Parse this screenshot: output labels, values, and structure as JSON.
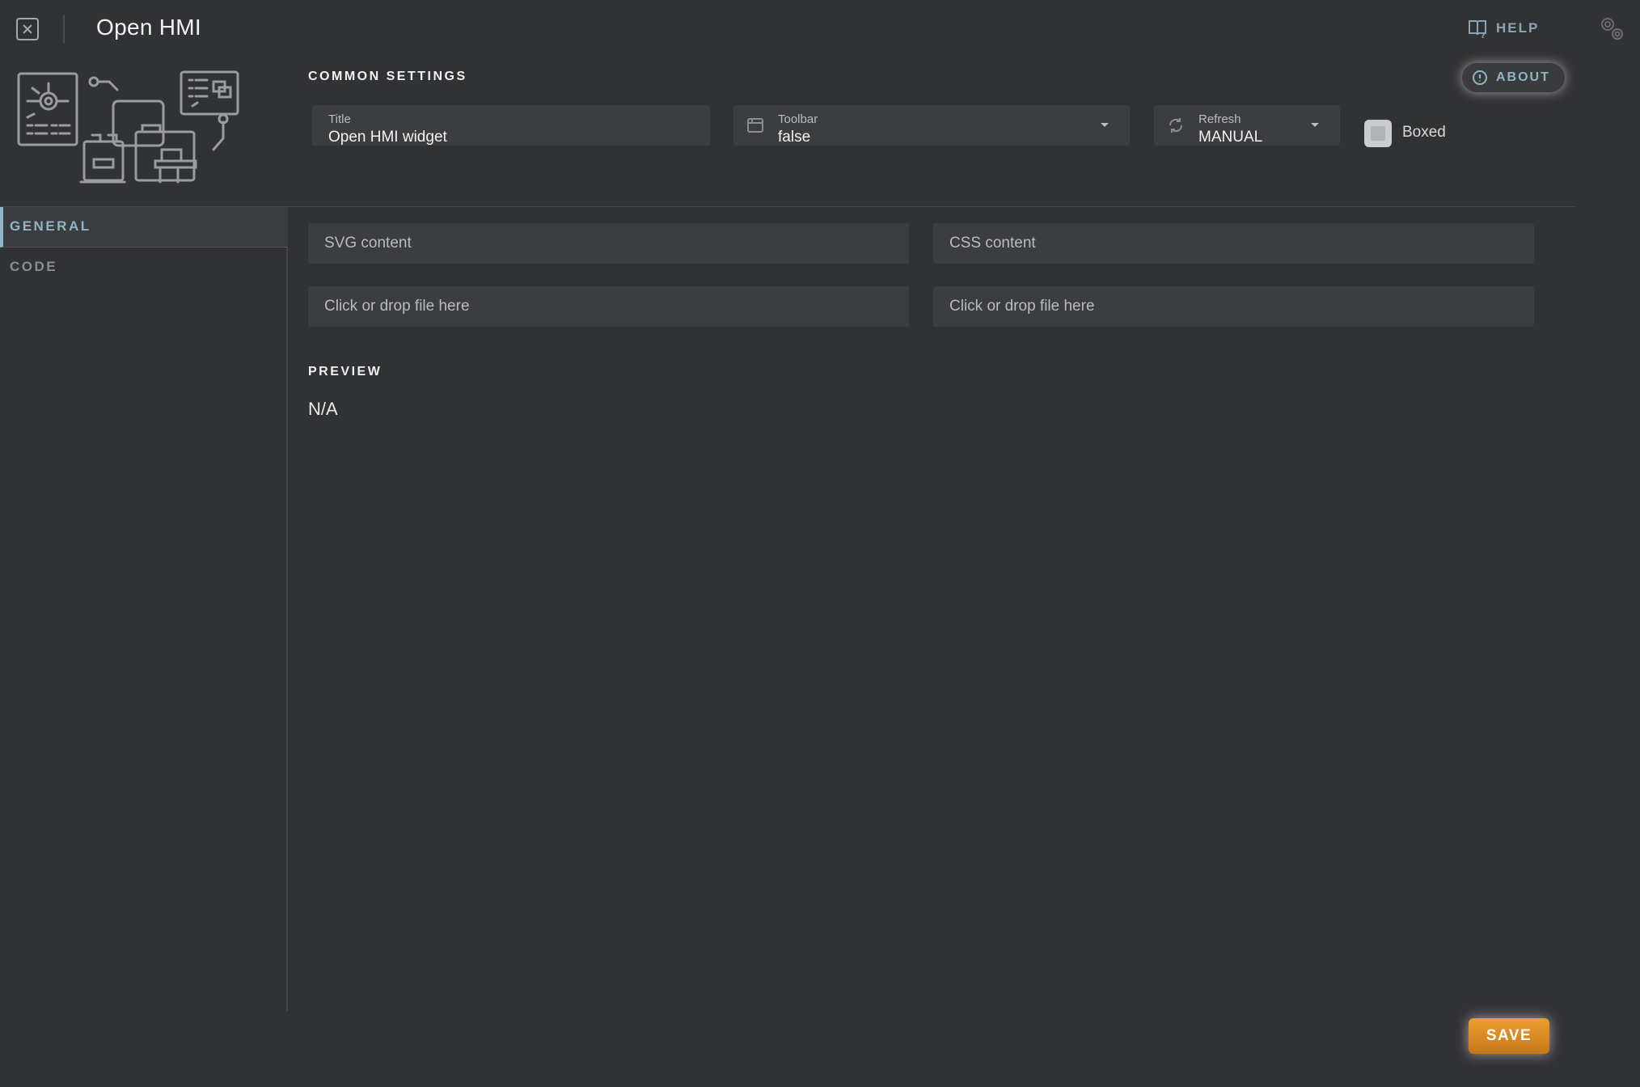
{
  "header": {
    "app_title": "Open HMI",
    "help_label": "HELP"
  },
  "settings": {
    "section_title": "COMMON SETTINGS",
    "about_label": "ABOUT",
    "title_field": {
      "label": "Title",
      "value": "Open HMI widget"
    },
    "toolbar_field": {
      "label": "Toolbar",
      "value": "false"
    },
    "refresh_field": {
      "label": "Refresh",
      "value": "MANUAL"
    },
    "boxed_label": "Boxed",
    "boxed_checked": false
  },
  "sidebar": {
    "items": [
      {
        "label": "GENERAL",
        "active": true
      },
      {
        "label": "CODE",
        "active": false
      }
    ]
  },
  "content": {
    "svg_content_label": "SVG content",
    "css_content_label": "CSS content",
    "svg_drop_text": "Click or drop file here",
    "css_drop_text": "Click or drop file here",
    "preview_title": "PREVIEW",
    "preview_value": "N/A"
  },
  "footer": {
    "save_label": "SAVE"
  },
  "colors": {
    "background": "#313234",
    "accent": "#8fb6c4",
    "save": "#e0922a"
  }
}
